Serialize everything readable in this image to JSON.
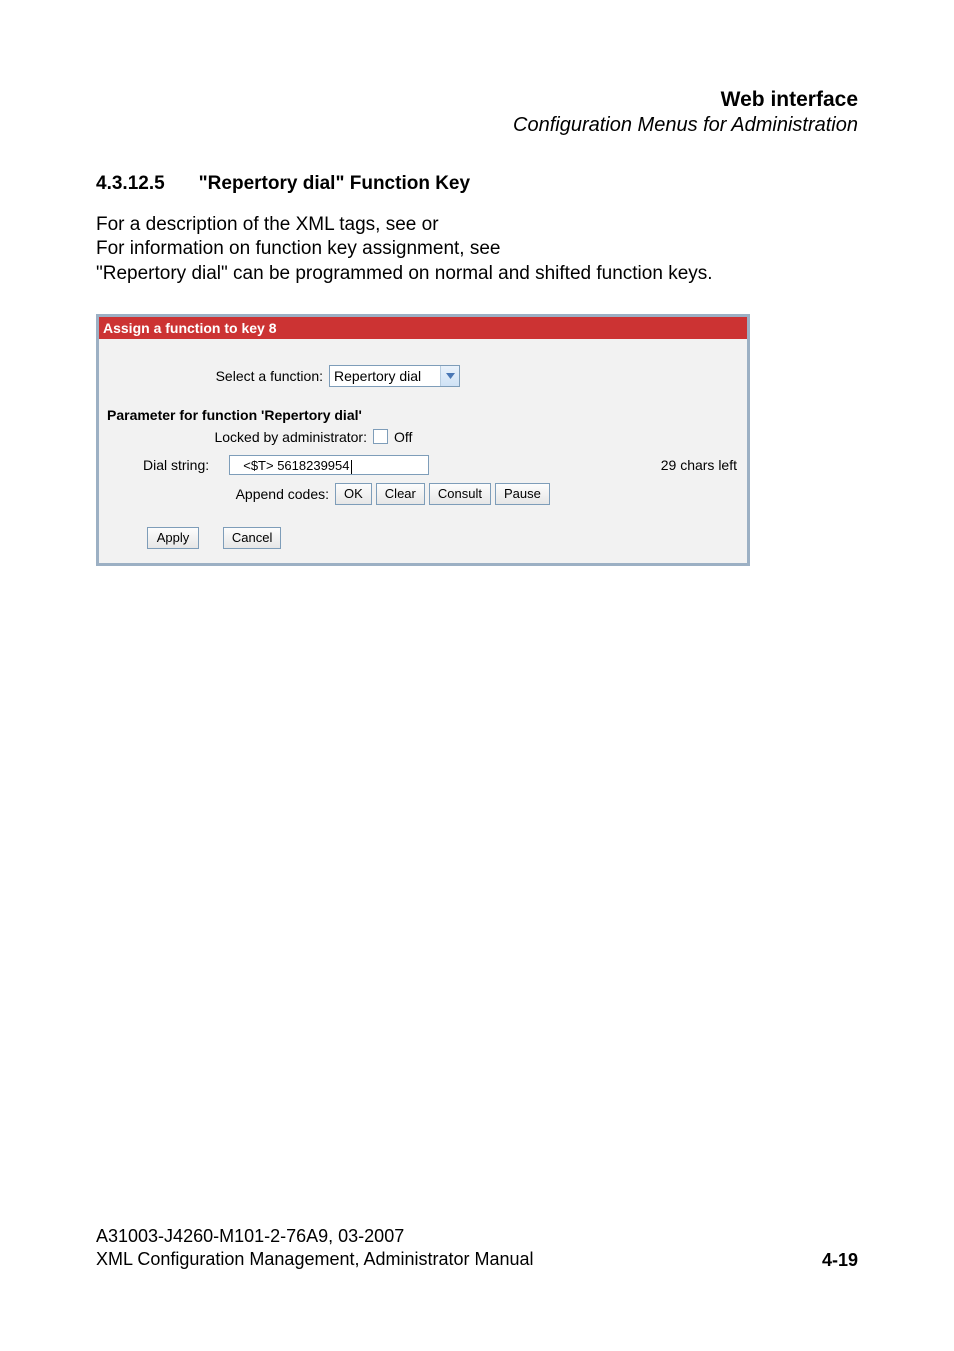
{
  "header": {
    "title": "Web interface",
    "subtitle": "Configuration Menus for Administration"
  },
  "section": {
    "number": "4.3.12.5",
    "title": "\"Repertory dial\" Function Key"
  },
  "body": {
    "line1": "For a description of the XML tags, see  or",
    "line2": "For information on function key assignment, see",
    "line3": "\"Repertory dial\" can be programmed on normal and shifted function keys."
  },
  "panel": {
    "title": "Assign a function to key 8",
    "function_label": "Select a function:",
    "function_value": "Repertory dial",
    "param_heading": "Parameter for function 'Repertory dial'",
    "locked_label": "Locked by administrator:",
    "locked_value": "Off",
    "dial_label": "Dial string:",
    "dial_value": "  <$T> 5618239954",
    "chars_left": "29 chars left",
    "append_label": "Append codes:",
    "buttons": {
      "ok": "OK",
      "clear": "Clear",
      "consult": "Consult",
      "pause": "Pause",
      "apply": "Apply",
      "cancel": "Cancel"
    }
  },
  "footer": {
    "line1": "A31003-J4260-M101-2-76A9, 03-2007",
    "line2": "XML Configuration Management, Administrator Manual",
    "page": "4-19"
  }
}
